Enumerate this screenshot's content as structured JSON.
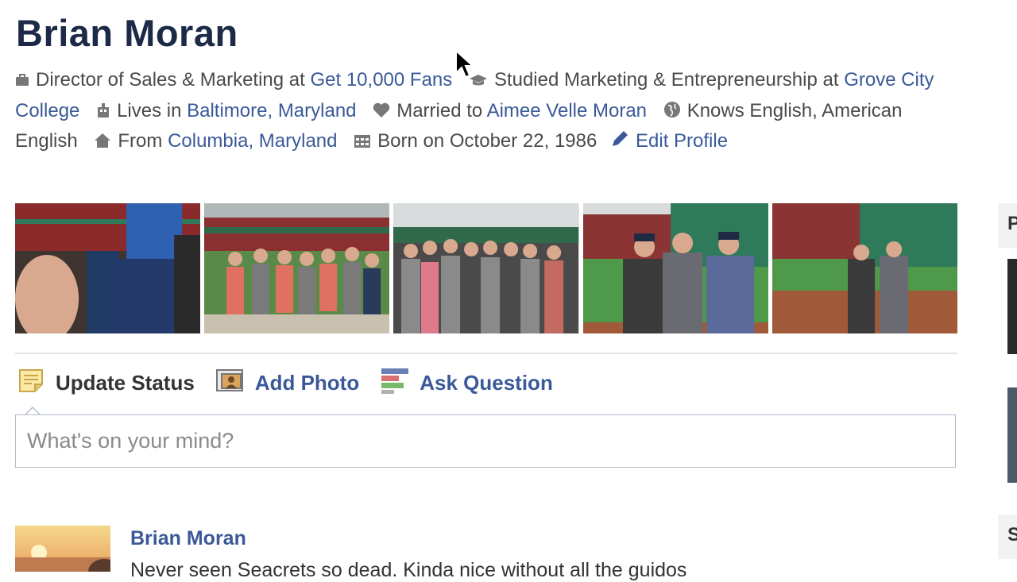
{
  "profile": {
    "name": "Brian Moran",
    "info": {
      "work_prefix": "Director of Sales & Marketing at",
      "work_link": "Get 10,000 Fans",
      "study_prefix": "Studied Marketing & Entrepreneurship at",
      "study_link": "Grove City College",
      "lives_prefix": "Lives in",
      "lives_link": "Baltimore, Maryland",
      "married_prefix": "Married to",
      "married_link": "Aimee Velle Moran",
      "languages": "Knows English, American English",
      "from_prefix": "From",
      "from_link": "Columbia, Maryland",
      "born": "Born on October 22, 1986",
      "edit_profile": "Edit Profile"
    }
  },
  "composer": {
    "tabs": [
      {
        "label": "Update Status",
        "icon": "status-note-icon",
        "active": true
      },
      {
        "label": "Add Photo",
        "icon": "photo-icon",
        "active": false
      },
      {
        "label": "Ask Question",
        "icon": "question-poll-icon",
        "active": false
      }
    ],
    "placeholder": "What's on your mind?"
  },
  "feed": {
    "story": {
      "author": "Brian Moran",
      "text": "Never seen Seacrets so dead. Kinda nice without all the guidos"
    }
  },
  "right_column": {
    "letters": [
      "P",
      "S"
    ]
  },
  "colors": {
    "link": "#3b5998",
    "name": "#1c2a47",
    "text": "#4a4a4a",
    "border": "#b4bbcd"
  }
}
